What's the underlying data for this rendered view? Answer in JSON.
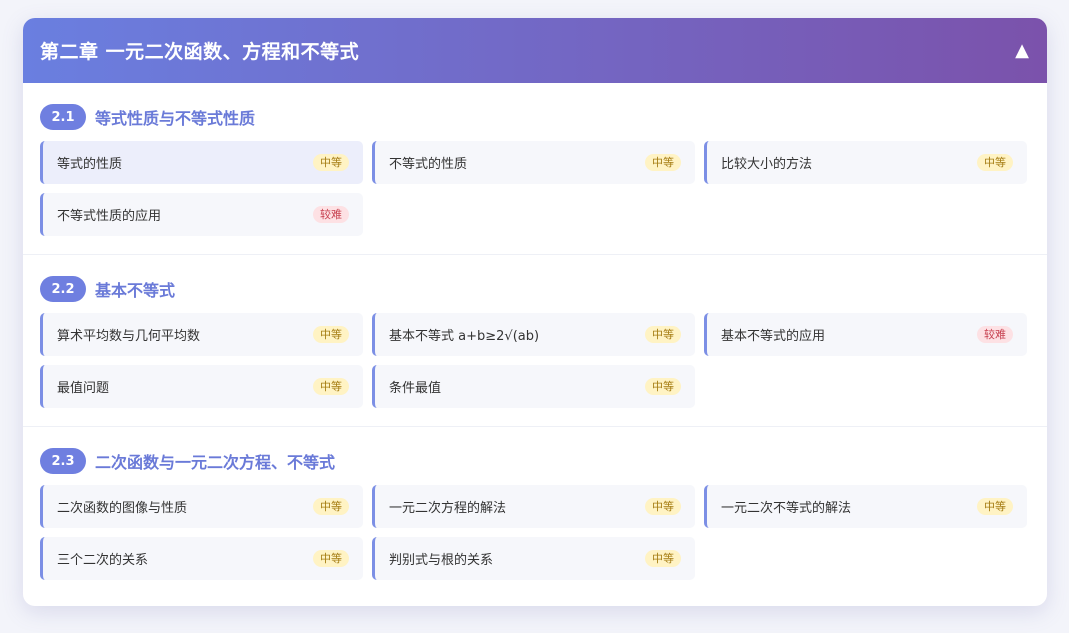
{
  "chapter": {
    "title": "第二章 一元二次函数、方程和不等式",
    "collapse_glyph": "▲"
  },
  "colors": {
    "header_gradient_start": "#6a7fe0",
    "header_gradient_end": "#7b52ab",
    "accent": "#6f7fe0",
    "tag_medium_bg": "#fff3c4",
    "tag_hard_bg": "#fde1e4"
  },
  "sections": [
    {
      "number": "2.1",
      "title": "等式性质与不等式性质",
      "items": [
        {
          "label": "等式的性质",
          "difficulty": "中等",
          "level": "medium",
          "active": true
        },
        {
          "label": "不等式的性质",
          "difficulty": "中等",
          "level": "medium"
        },
        {
          "label": "比较大小的方法",
          "difficulty": "中等",
          "level": "medium"
        },
        {
          "label": "不等式性质的应用",
          "difficulty": "较难",
          "level": "hard"
        }
      ]
    },
    {
      "number": "2.2",
      "title": "基本不等式",
      "items": [
        {
          "label": "算术平均数与几何平均数",
          "difficulty": "中等",
          "level": "medium"
        },
        {
          "label": "基本不等式 a+b≥2√(ab)",
          "difficulty": "中等",
          "level": "medium"
        },
        {
          "label": "基本不等式的应用",
          "difficulty": "较难",
          "level": "hard"
        },
        {
          "label": "最值问题",
          "difficulty": "中等",
          "level": "medium"
        },
        {
          "label": "条件最值",
          "difficulty": "中等",
          "level": "medium"
        }
      ]
    },
    {
      "number": "2.3",
      "title": "二次函数与一元二次方程、不等式",
      "items": [
        {
          "label": "二次函数的图像与性质",
          "difficulty": "中等",
          "level": "medium"
        },
        {
          "label": "一元二次方程的解法",
          "difficulty": "中等",
          "level": "medium"
        },
        {
          "label": "一元二次不等式的解法",
          "difficulty": "中等",
          "level": "medium"
        },
        {
          "label": "三个二次的关系",
          "difficulty": "中等",
          "level": "medium"
        },
        {
          "label": "判别式与根的关系",
          "difficulty": "中等",
          "level": "medium"
        }
      ]
    }
  ]
}
